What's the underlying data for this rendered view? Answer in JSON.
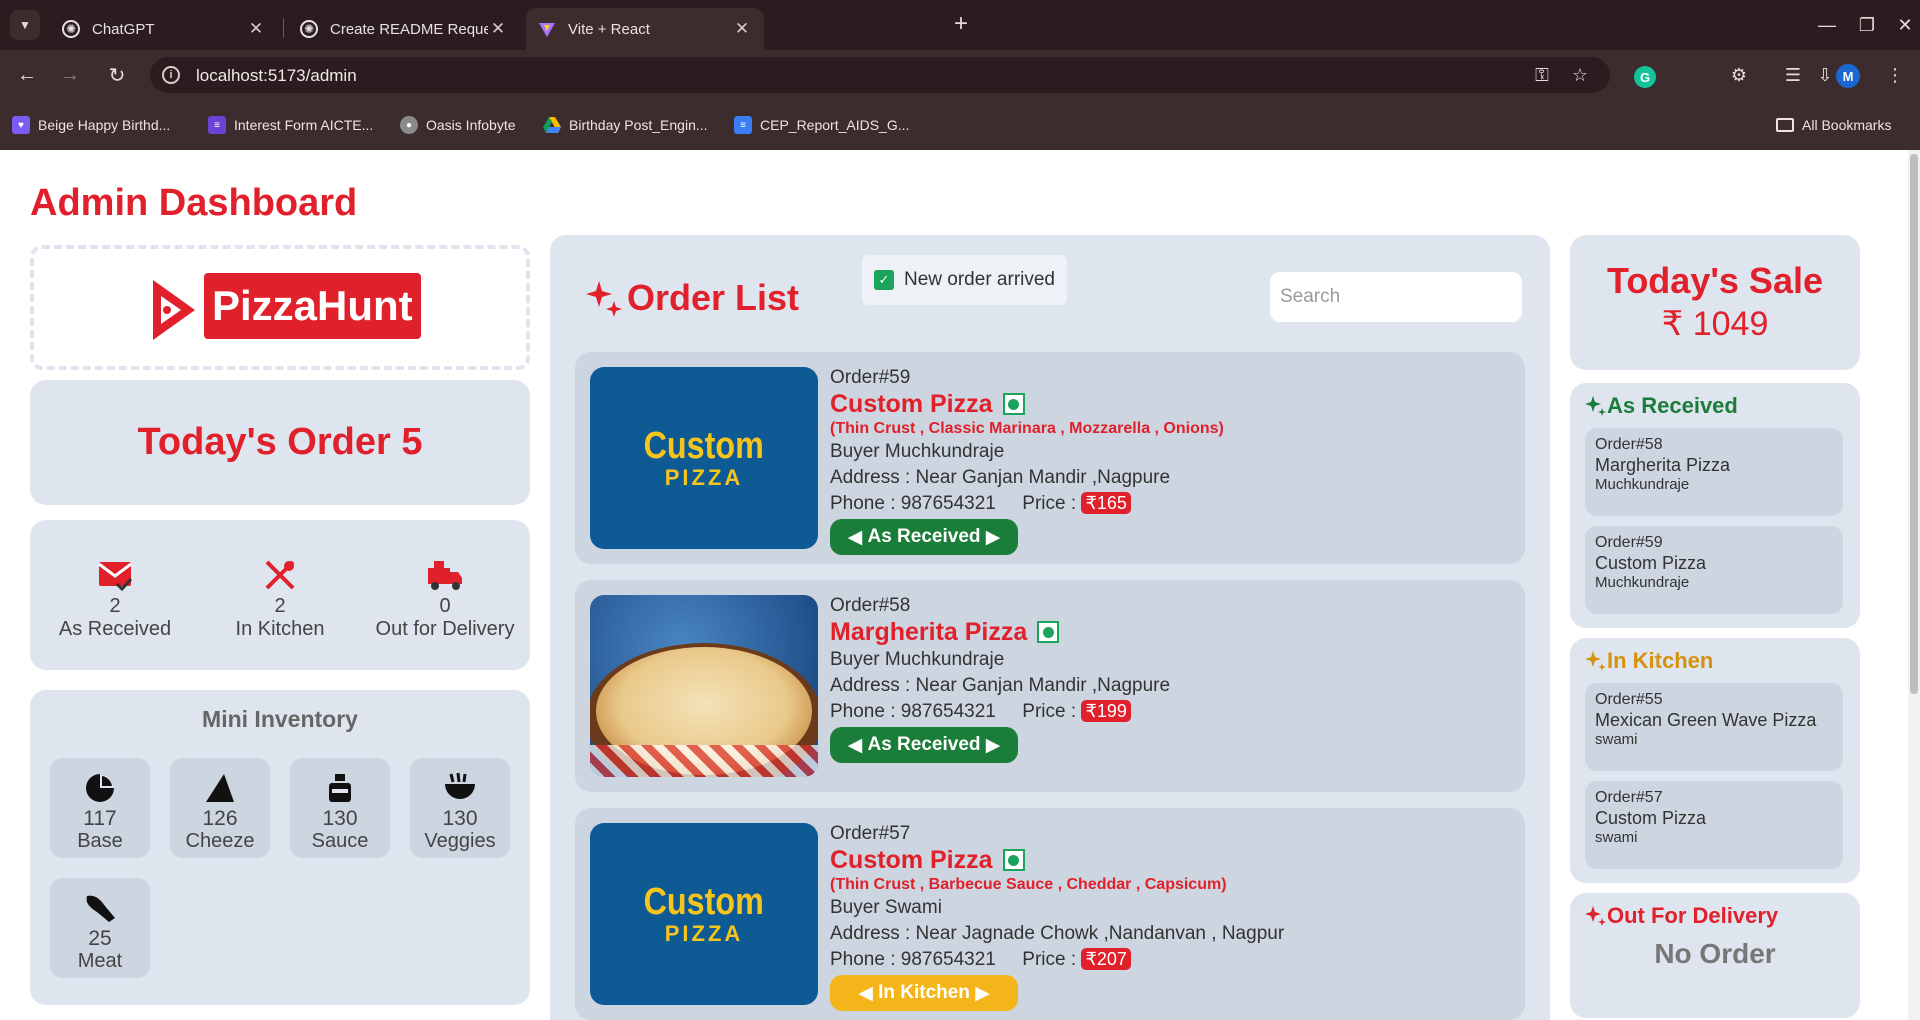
{
  "browser": {
    "tabs": [
      {
        "title": "ChatGPT"
      },
      {
        "title": "Create README Request"
      },
      {
        "title": "Vite + React"
      }
    ],
    "url": "localhost:5173/admin",
    "avatar_letter": "M",
    "bookmarks": [
      {
        "label": "Beige Happy Birthd..."
      },
      {
        "label": "Interest Form AICTE..."
      },
      {
        "label": "Oasis Infobyte"
      },
      {
        "label": "Birthday Post_Engin..."
      },
      {
        "label": "CEP_Report_AIDS_G..."
      }
    ],
    "all_bookmarks": "All Bookmarks"
  },
  "page": {
    "title": "Admin Dashboard",
    "brand": "PizzaHunt",
    "todays_order": "Today's Order 5",
    "status": [
      {
        "count": "2",
        "label": "As Received",
        "icon": "mail-check-icon"
      },
      {
        "count": "2",
        "label": "In Kitchen",
        "icon": "utensils-icon"
      },
      {
        "count": "0",
        "label": "Out for Delivery",
        "icon": "delivery-truck-icon"
      }
    ],
    "inventory": {
      "title": "Mini Inventory",
      "items": [
        {
          "count": "117",
          "label": "Base",
          "icon": "pie-icon"
        },
        {
          "count": "126",
          "label": "Cheeze",
          "icon": "cheese-icon"
        },
        {
          "count": "130",
          "label": "Sauce",
          "icon": "bottle-icon"
        },
        {
          "count": "130",
          "label": "Veggies",
          "icon": "bowl-icon"
        },
        {
          "count": "25",
          "label": "Meat",
          "icon": "meat-icon"
        }
      ]
    }
  },
  "orders": {
    "title": "Order List",
    "toast": "New order arrived",
    "search_placeholder": "Search",
    "list": [
      {
        "number": "Order#59",
        "name": "Custom Pizza",
        "toppings": "(Thin Crust , Classic Marinara , Mozzarella , Onions)",
        "buyer": "Buyer Muchkundraje",
        "address": "Address : Near Ganjan Mandir ,Nagpure",
        "phone": "Phone : 987654321",
        "price_label": "Price :",
        "price": "₹165",
        "status": "As Received",
        "status_color": "#1b7d3a",
        "image_line1": "Custom",
        "image_line2": "PIZZA"
      },
      {
        "number": "Order#58",
        "name": "Margherita Pizza",
        "toppings": "",
        "buyer": "Buyer Muchkundraje",
        "address": "Address : Near Ganjan Mandir ,Nagpure",
        "phone": "Phone : 987654321",
        "price_label": "Price :",
        "price": "₹199",
        "status": "As Received",
        "status_color": "#1b7d3a"
      },
      {
        "number": "Order#57",
        "name": "Custom Pizza",
        "toppings": "(Thin Crust , Barbecue Sauce , Cheddar , Capsicum)",
        "buyer": "Buyer Swami",
        "address": "Address : Near Jagnade Chowk ,Nandanvan , Nagpur",
        "phone": "Phone : 987654321",
        "price_label": "Price :",
        "price": "₹207",
        "status": "In Kitchen",
        "status_color": "#f3b51a",
        "image_line1": "Custom",
        "image_line2": "PIZZA"
      }
    ]
  },
  "sidebar": {
    "sale_title": "Today's Sale",
    "sale_value": "₹ 1049",
    "as_received": {
      "title": "As Received",
      "color": "#1b7d3a",
      "items": [
        {
          "number": "Order#58",
          "pizza": "Margherita Pizza",
          "buyer": "Muchkundraje"
        },
        {
          "number": "Order#59",
          "pizza": "Custom Pizza",
          "buyer": "Muchkundraje"
        }
      ]
    },
    "in_kitchen": {
      "title": "In Kitchen",
      "color": "#d4920f",
      "items": [
        {
          "number": "Order#55",
          "pizza": "Mexican Green Wave Pizza",
          "buyer": "swami"
        },
        {
          "number": "Order#57",
          "pizza": "Custom Pizza",
          "buyer": "swami"
        }
      ]
    },
    "out_for_delivery": {
      "title": "Out For Delivery",
      "color": "#e0202a",
      "empty": "No Order"
    }
  },
  "colors": {
    "accent": "#e0202a",
    "card": "#dfe5ee",
    "inner_card": "#cdd5e0"
  }
}
